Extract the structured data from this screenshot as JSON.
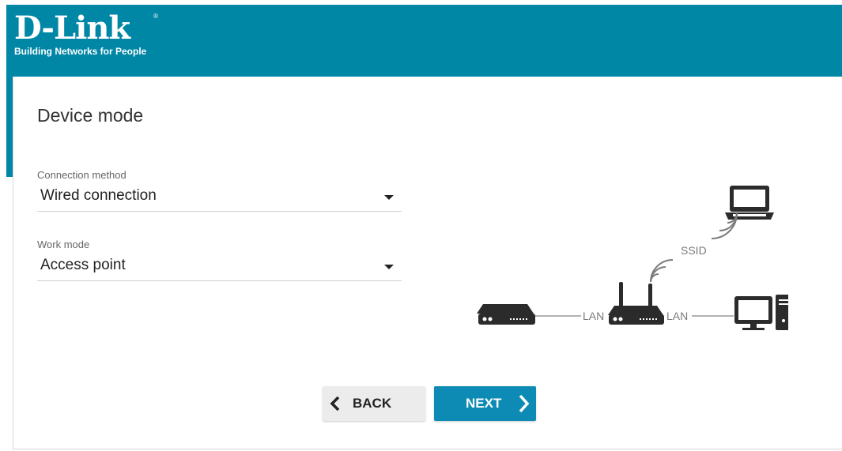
{
  "brand": {
    "logo_text": "D-Link",
    "tagline": "Building Networks for People",
    "registered_mark": "®"
  },
  "page": {
    "title": "Device mode"
  },
  "connection_method": {
    "label": "Connection method",
    "value": "Wired connection"
  },
  "work_mode": {
    "label": "Work mode",
    "value": "Access point"
  },
  "diagram": {
    "ssid_label": "SSID",
    "lan_label_left": "LAN",
    "lan_label_right": "LAN"
  },
  "buttons": {
    "back_label": "BACK",
    "next_label": "NEXT"
  },
  "colors": {
    "header": "#0087a6",
    "primary_button": "#0d8bb4",
    "secondary_button": "#ececec",
    "icon": "#2b2b2b"
  }
}
